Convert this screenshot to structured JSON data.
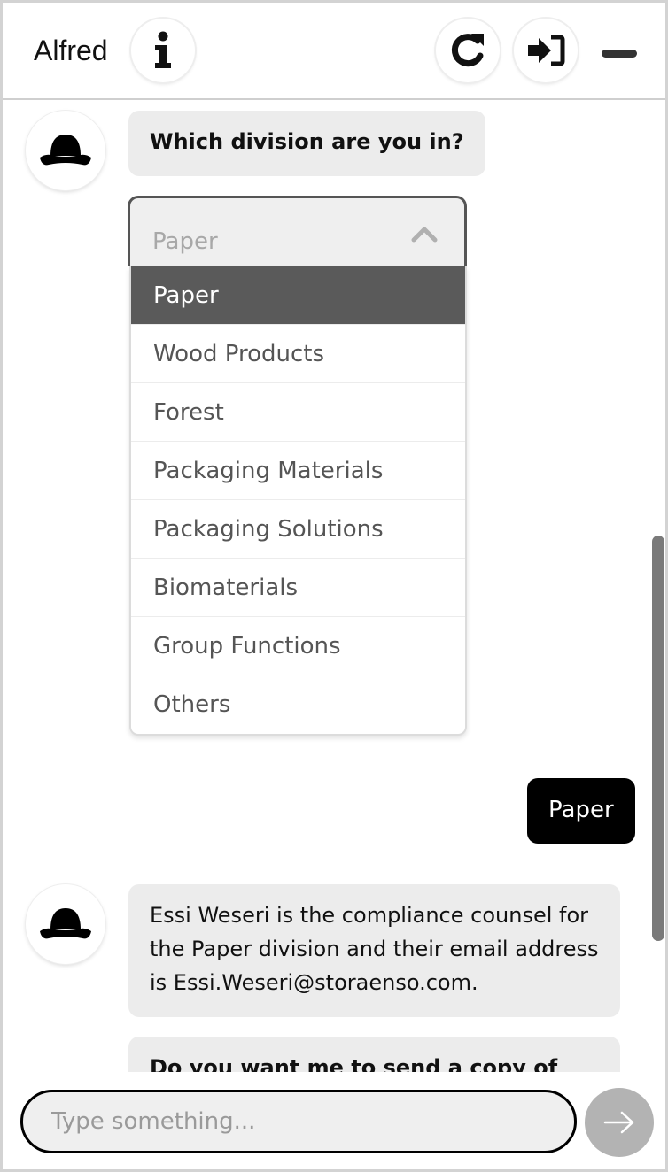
{
  "header": {
    "title": "Alfred",
    "info_icon": "info-icon",
    "refresh_icon": "refresh-icon",
    "login_icon": "sign-in-icon",
    "minimize_icon": "minimize-icon"
  },
  "messages": {
    "question": "Which division are you in?",
    "user_reply": "Paper",
    "answer": "Essi Weseri is the compliance counsel for the Paper division and their email address is Essi.Weseri@storaenso.com.",
    "followup_partial": "Do you want me to send a copy of our"
  },
  "division_select": {
    "selected": "Paper",
    "options": [
      "Paper",
      "Wood Products",
      "Forest",
      "Packaging Materials",
      "Packaging Solutions",
      "Biomaterials",
      "Group Functions",
      "Others"
    ]
  },
  "composer": {
    "placeholder": "Type something...",
    "send_icon": "arrow-right-icon"
  },
  "colors": {
    "user_bubble": "#000000",
    "bot_bubble": "#ececec",
    "selected_option": "#5a5a5a",
    "send_button": "#b3b3b3"
  }
}
